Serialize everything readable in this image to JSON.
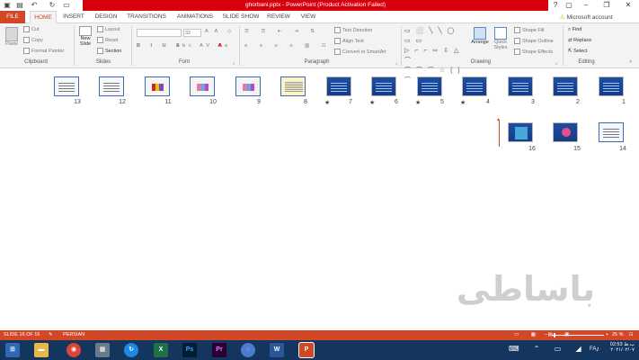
{
  "window": {
    "title": "ghorbani.pptx - PowerPoint (Product Activation Failed)",
    "help": "?",
    "account": "Microsoft account"
  },
  "tabs": [
    "FILE",
    "HOME",
    "INSERT",
    "DESIGN",
    "TRANSITIONS",
    "ANIMATIONS",
    "SLIDE SHOW",
    "REVIEW",
    "VIEW"
  ],
  "ribbon": {
    "clipboard": {
      "label": "Clipboard",
      "paste": "Paste",
      "cut": "Cut",
      "copy": "Copy",
      "format_painter": "Format Painter"
    },
    "slides": {
      "label": "Slides",
      "new_slide": "New",
      "new_slide2": "Slide",
      "layout": "Layout",
      "reset": "Reset",
      "section": "Section"
    },
    "font": {
      "label": "Font",
      "font_size": "32"
    },
    "paragraph": {
      "label": "Paragraph",
      "text_direction": "Text Direction",
      "align_text": "Align Text",
      "convert_smartart": "Convert to SmartArt"
    },
    "drawing": {
      "label": "Drawing",
      "arrange": "Arrange",
      "quick_styles": "Quick",
      "quick_styles2": "Styles",
      "shape_fill": "Shape Fill",
      "shape_outline": "Shape Outline",
      "shape_effects": "Shape Effects"
    },
    "editing": {
      "label": "Editing",
      "find": "Find",
      "replace": "Replace",
      "select": "Select"
    }
  },
  "slides_row1": [
    {
      "num": "13"
    },
    {
      "num": "12"
    },
    {
      "num": "11"
    },
    {
      "num": "10"
    },
    {
      "num": "9"
    },
    {
      "num": "8"
    },
    {
      "num": "7"
    },
    {
      "num": "6"
    },
    {
      "num": "5"
    },
    {
      "num": "4"
    },
    {
      "num": "3"
    },
    {
      "num": "2"
    },
    {
      "num": "1"
    }
  ],
  "slides_row2": [
    {
      "num": "16"
    },
    {
      "num": "15"
    },
    {
      "num": "14"
    }
  ],
  "animation_marker": "★",
  "watermark": "باساطی",
  "status": {
    "slide_info": "SLIDE 16 OF 16",
    "language": "PERSIAN",
    "zoom": "25 %"
  },
  "taskbar": {
    "lang": "FA",
    "time": "02:53 ب.ظ",
    "date": "۲۰۲۱/۰۲/۰۷"
  }
}
